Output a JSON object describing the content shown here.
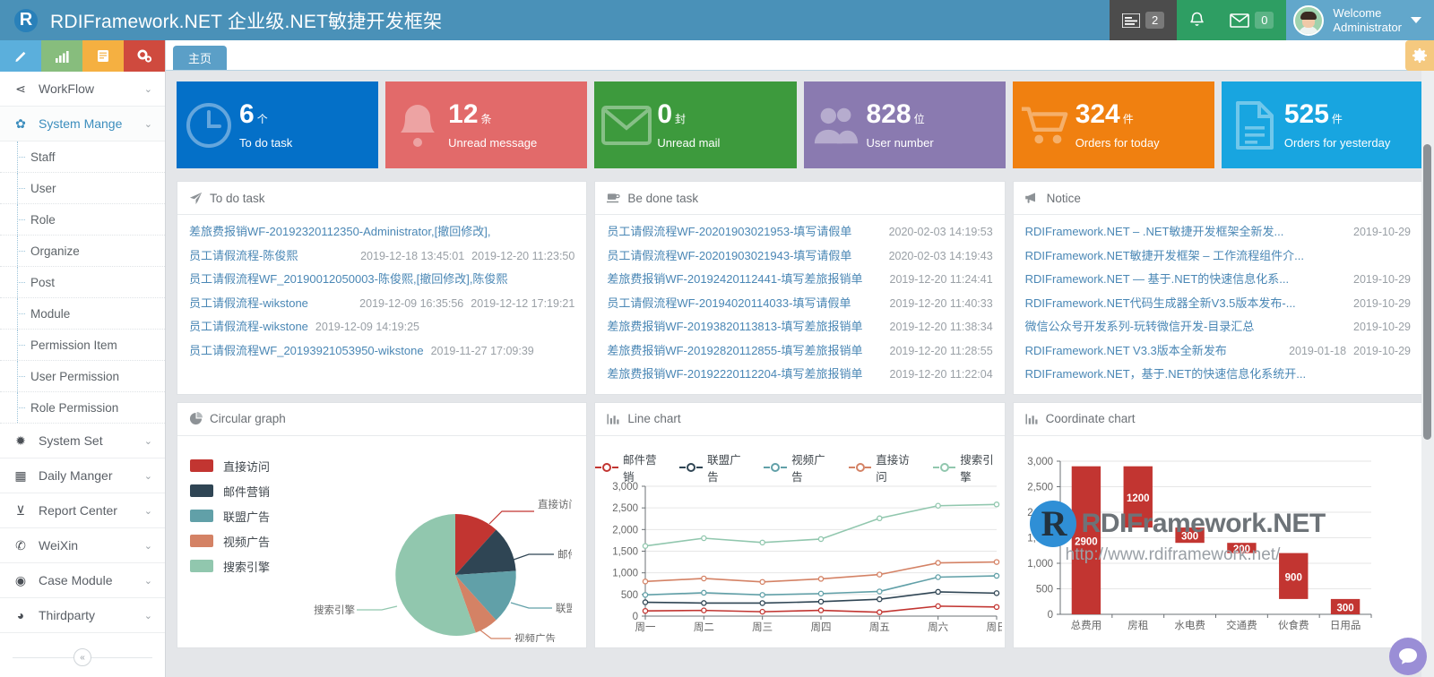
{
  "header": {
    "brand_logo_letter": "R",
    "title": "RDIFramework.NET 企业级.NET敏捷开发框架",
    "msg_count": "2",
    "mail_count": "0",
    "bell_icon": "bell-icon",
    "list_icon": "list-icon",
    "mail_icon": "mail-icon",
    "welcome_line1": "Welcome",
    "welcome_line2": "Administrator"
  },
  "sidebar": {
    "quick_icons": [
      {
        "name": "pencil-icon",
        "glyph": "✎",
        "color": "#5bafdc"
      },
      {
        "name": "chart-bars-icon",
        "glyph": "▁▃▅",
        "color": "#87bd7d"
      },
      {
        "name": "book-icon",
        "glyph": "▤",
        "color": "#f5b041"
      },
      {
        "name": "gears-icon",
        "glyph": "✿",
        "color": "#cf4a3e"
      }
    ],
    "groups": [
      {
        "label": "WorkFlow",
        "icon": "share-icon",
        "glyph": "⋖",
        "active": false,
        "children": []
      },
      {
        "label": "System Mange",
        "icon": "gears-icon",
        "glyph": "✿",
        "active": true,
        "children": [
          "Staff",
          "User",
          "Role",
          "Organize",
          "Post",
          "Module",
          "Permission Item",
          "User Permission",
          "Role Permission"
        ]
      },
      {
        "label": "System Set",
        "icon": "sun-icon",
        "glyph": "✹",
        "active": false,
        "children": []
      },
      {
        "label": "Daily Manger",
        "icon": "calendar-icon",
        "glyph": "▦",
        "active": false,
        "children": []
      },
      {
        "label": "Report Center",
        "icon": "funnel-icon",
        "glyph": "⊻",
        "active": false,
        "children": []
      },
      {
        "label": "WeiXin",
        "icon": "wechat-icon",
        "glyph": "✆",
        "active": false,
        "children": []
      },
      {
        "label": "Case Module",
        "icon": "eye-icon",
        "glyph": "◉",
        "active": false,
        "children": []
      },
      {
        "label": "Thirdparty",
        "icon": "globe-icon",
        "glyph": "◕",
        "active": false,
        "children": []
      }
    ],
    "collapse_glyph": "«"
  },
  "tabs": {
    "items": [
      {
        "label": "主页",
        "active": true
      }
    ],
    "settings_icon": "gear-icon"
  },
  "stats": [
    {
      "value": "6",
      "unit": "个",
      "label": "To do task",
      "color": "#0470c8",
      "icon": "clock-icon"
    },
    {
      "value": "12",
      "unit": "条",
      "label": "Unread message",
      "color": "#e26a6a",
      "icon": "bell-icon"
    },
    {
      "value": "0",
      "unit": "封",
      "label": "Unread mail",
      "color": "#3d9a3d",
      "icon": "envelope-icon"
    },
    {
      "value": "828",
      "unit": "位",
      "label": "User number",
      "color": "#8a7ab0",
      "icon": "users-icon"
    },
    {
      "value": "324",
      "unit": "件",
      "label": "Orders for today",
      "color": "#f08010",
      "icon": "cart-icon"
    },
    {
      "value": "525",
      "unit": "件",
      "label": "Orders for yesterday",
      "color": "#18a5e0",
      "icon": "document-icon"
    }
  ],
  "todo_panel": {
    "title": "To do task",
    "icon": "paper-plane-icon",
    "rows": [
      {
        "link": "差旅费报销WF-20192320112350-Administrator,[撤回修改],",
        "time": "",
        "time2": ""
      },
      {
        "link": "员工请假流程-陈俊熙",
        "time": "2019-12-18 13:45:01",
        "time2": "2019-12-20 11:23:50"
      },
      {
        "link": "员工请假流程WF_20190012050003-陈俊熙,[撤回修改],陈俊熙",
        "time": "",
        "time2": ""
      },
      {
        "link": "员工请假流程-wikstone",
        "time": "2019-12-09 16:35:56",
        "time2": "2019-12-12 17:19:21"
      },
      {
        "link": "员工请假流程-wikstone",
        "time": "",
        "time2": "2019-12-09 14:19:25"
      },
      {
        "link": "员工请假流程WF_20193921053950-wikstone",
        "time": "",
        "time2": "2019-11-27 17:09:39"
      }
    ]
  },
  "done_panel": {
    "title": "Be done task",
    "icon": "coffee-icon",
    "rows": [
      {
        "link": "员工请假流程WF-20201903021953-填写请假单",
        "time": "2020-02-03 14:19:53"
      },
      {
        "link": "员工请假流程WF-20201903021943-填写请假单",
        "time": "2020-02-03 14:19:43"
      },
      {
        "link": "差旅费报销WF-20192420112441-填写差旅报销单",
        "time": "2019-12-20 11:24:41"
      },
      {
        "link": "员工请假流程WF-20194020114033-填写请假单",
        "time": "2019-12-20 11:40:33"
      },
      {
        "link": "差旅费报销WF-20193820113813-填写差旅报销单",
        "time": "2019-12-20 11:38:34"
      },
      {
        "link": "差旅费报销WF-20192820112855-填写差旅报销单",
        "time": "2019-12-20 11:28:55"
      },
      {
        "link": "差旅费报销WF-20192220112204-填写差旅报销单",
        "time": "2019-12-20 11:22:04"
      }
    ]
  },
  "notice_panel": {
    "title": "Notice",
    "icon": "megaphone-icon",
    "rows": [
      {
        "link": "RDIFramework.NET – .NET敏捷开发框架全新发...",
        "time": "2019-10-29",
        "time2": ""
      },
      {
        "link": "RDIFramework.NET敏捷开发框架 – 工作流程组件介...",
        "time": "",
        "time2": ""
      },
      {
        "link": "RDIFramework.NET — 基于.NET的快速信息化系...",
        "time": "2019-10-29",
        "time2": ""
      },
      {
        "link": "RDIFramework.NET代码生成器全新V3.5版本发布-...",
        "time": "2019-10-29",
        "time2": ""
      },
      {
        "link": "微信公众号开发系列-玩转微信开发-目录汇总",
        "time": "2019-10-29",
        "time2": ""
      },
      {
        "link": "RDIFramework.NET V3.3版本全新发布",
        "time": "2019-01-18",
        "time2": "2019-10-29"
      },
      {
        "link": "RDIFramework.NET，基于.NET的快速信息化系统开...",
        "time": "",
        "time2": ""
      }
    ]
  },
  "pie_panel": {
    "title": "Circular graph",
    "icon": "pie-chart-icon"
  },
  "line_panel": {
    "title": "Line chart",
    "icon": "bar-chart-icon"
  },
  "coord_panel": {
    "title": "Coordinate chart",
    "icon": "bar-chart-icon"
  },
  "watermark": {
    "logo_letter": "R",
    "title": "RDIFramework.NET",
    "url": "http://www.rdiframework.net/"
  },
  "chat": {
    "icon": "chat-bubble-icon"
  },
  "chart_data": [
    {
      "type": "pie",
      "title": "Circular graph",
      "legend_position": "left",
      "labels": [
        "直接访问",
        "邮件营销",
        "联盟广告",
        "视频广告",
        "搜索引擎"
      ],
      "values": [
        335,
        310,
        234,
        135,
        1548
      ],
      "colors": [
        "#c23531",
        "#2f4554",
        "#61a0a8",
        "#d48265",
        "#91c7ae"
      ],
      "annotations": [
        "直接访问",
        "邮件营销",
        "联盟广告",
        "视频广告",
        "搜索引擎"
      ]
    },
    {
      "type": "line",
      "title": "Line chart",
      "legend_position": "top",
      "categories": [
        "周一",
        "周二",
        "周三",
        "周四",
        "周五",
        "周六",
        "周日"
      ],
      "ylim": [
        0,
        3000
      ],
      "yticks": [
        "0",
        "500",
        "1,000",
        "1,500",
        "2,000",
        "2,500",
        "3,000"
      ],
      "xlabel": "",
      "ylabel": "",
      "grid": true,
      "series": [
        {
          "name": "邮件营销",
          "color": "#c23531",
          "values": [
            120,
            132,
            101,
            134,
            90,
            230,
            210
          ]
        },
        {
          "name": "联盟广告",
          "color": "#2f4554",
          "values": [
            320,
            302,
            301,
            334,
            390,
            560,
            530
          ]
        },
        {
          "name": "视频广告",
          "color": "#61a0a8",
          "values": [
            490,
            540,
            490,
            520,
            570,
            900,
            930
          ]
        },
        {
          "name": "直接访问",
          "color": "#d48265",
          "values": [
            800,
            870,
            790,
            860,
            960,
            1230,
            1250
          ]
        },
        {
          "name": "搜索引擎",
          "color": "#91c7ae",
          "values": [
            1620,
            1800,
            1700,
            1780,
            2260,
            2550,
            2580
          ]
        }
      ]
    },
    {
      "type": "bar",
      "title": "Coordinate chart",
      "subtype": "waterfall",
      "categories": [
        "总费用",
        "房租",
        "水电费",
        "交通费",
        "伙食费",
        "日用品"
      ],
      "values": [
        2900,
        1200,
        300,
        200,
        900,
        300
      ],
      "bases": [
        0,
        1700,
        1400,
        1200,
        300,
        0
      ],
      "labels": [
        "2900",
        "1200",
        "300",
        "200",
        "900",
        "300"
      ],
      "color": "#c23531",
      "ylim": [
        0,
        3000
      ],
      "yticks": [
        "0",
        "500",
        "1,000",
        "1,500",
        "2,000",
        "2,500",
        "3,000"
      ],
      "grid": true
    }
  ]
}
